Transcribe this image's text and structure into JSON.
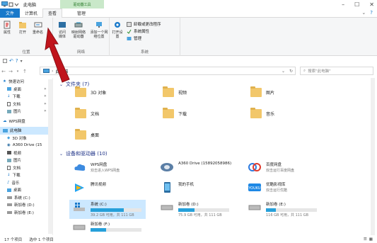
{
  "window": {
    "title": "此电脑",
    "context_tab": "驱动器工具"
  },
  "tabs": [
    {
      "label": "文件",
      "kind": "file"
    },
    {
      "label": "计算机"
    },
    {
      "label": "查看",
      "active": true
    },
    {
      "label": "管理"
    }
  ],
  "ribbon": {
    "location_group": {
      "label": "位置",
      "items": [
        {
          "label": "属性",
          "icon": "properties-icon"
        },
        {
          "label": "打开",
          "icon": "open-icon"
        },
        {
          "label": "重命名",
          "icon": "rename-icon"
        }
      ]
    },
    "network_group": {
      "label": "网络",
      "items": [
        {
          "label": "访问媒体",
          "icon": "media-icon"
        },
        {
          "label": "映射网络驱动器",
          "icon": "map-drive-icon"
        },
        {
          "label": "添加一个网络位置",
          "icon": "network-location-icon"
        }
      ]
    },
    "system_group": {
      "label": "系统",
      "open_settings": "打开设置",
      "items": [
        {
          "label": "卸载或更改程序"
        },
        {
          "label": "系统属性"
        },
        {
          "label": "管理"
        }
      ]
    }
  },
  "address": {
    "path": "此电脑",
    "search_placeholder": "搜索\"此电脑\""
  },
  "sidebar": {
    "quick_access": "快速访问",
    "items": [
      {
        "label": "桌面",
        "pinned": true
      },
      {
        "label": "下载",
        "pinned": true
      },
      {
        "label": "文档",
        "pinned": true
      },
      {
        "label": "图片",
        "pinned": true
      }
    ],
    "wps": "WPS网盘",
    "this_pc": "此电脑",
    "pc_items": [
      {
        "label": "3D 对象"
      },
      {
        "label": "A360 Drive (15"
      },
      {
        "label": "视频"
      },
      {
        "label": "图片"
      },
      {
        "label": "文档"
      },
      {
        "label": "下载"
      },
      {
        "label": "音乐"
      },
      {
        "label": "桌面"
      },
      {
        "label": "系统 (C:)"
      },
      {
        "label": "新加卷 (D:)"
      },
      {
        "label": "新加卷 (E:)"
      }
    ]
  },
  "folders": {
    "header": "文件夹 (7)",
    "items": [
      {
        "label": "3D 对象"
      },
      {
        "label": "视频"
      },
      {
        "label": "图片"
      },
      {
        "label": "文档"
      },
      {
        "label": "下载"
      },
      {
        "label": "音乐"
      },
      {
        "label": "桌面"
      }
    ]
  },
  "devices": {
    "header": "设备和驱动器 (10)",
    "items": [
      {
        "label": "WPS网盘",
        "sub": "双击进入WPS网盘"
      },
      {
        "label": "A360 Drive (15892058986)",
        "sub": ""
      },
      {
        "label": "百度网盘",
        "sub": "双击运行百度网盘"
      },
      {
        "label": "腾讯视频",
        "sub": ""
      },
      {
        "label": "我的手机",
        "sub": ""
      },
      {
        "label": "优酷影视库",
        "sub": "双击运行优酷"
      },
      {
        "label": "系统 (C:)",
        "free": "39.2 GB 可用，共 111 GB",
        "used": 0.65,
        "selected": true
      },
      {
        "label": "新加卷 (D:)",
        "free": "75.9 GB 可用，共 111 GB",
        "used": 0.32
      },
      {
        "label": "新加卷 (E:)",
        "free": "116 GB 可用，共 111 GB",
        "used": 0.2
      },
      {
        "label": "新加卷 (F:)",
        "free": "",
        "used": 0.3
      }
    ]
  },
  "status": {
    "count": "17 个项目",
    "selected": "选中 1 个项目"
  },
  "colors": {
    "accent": "#1979ca",
    "selection": "#cce8ff",
    "bar": "#26a0da",
    "arrow": "#c0141c"
  }
}
